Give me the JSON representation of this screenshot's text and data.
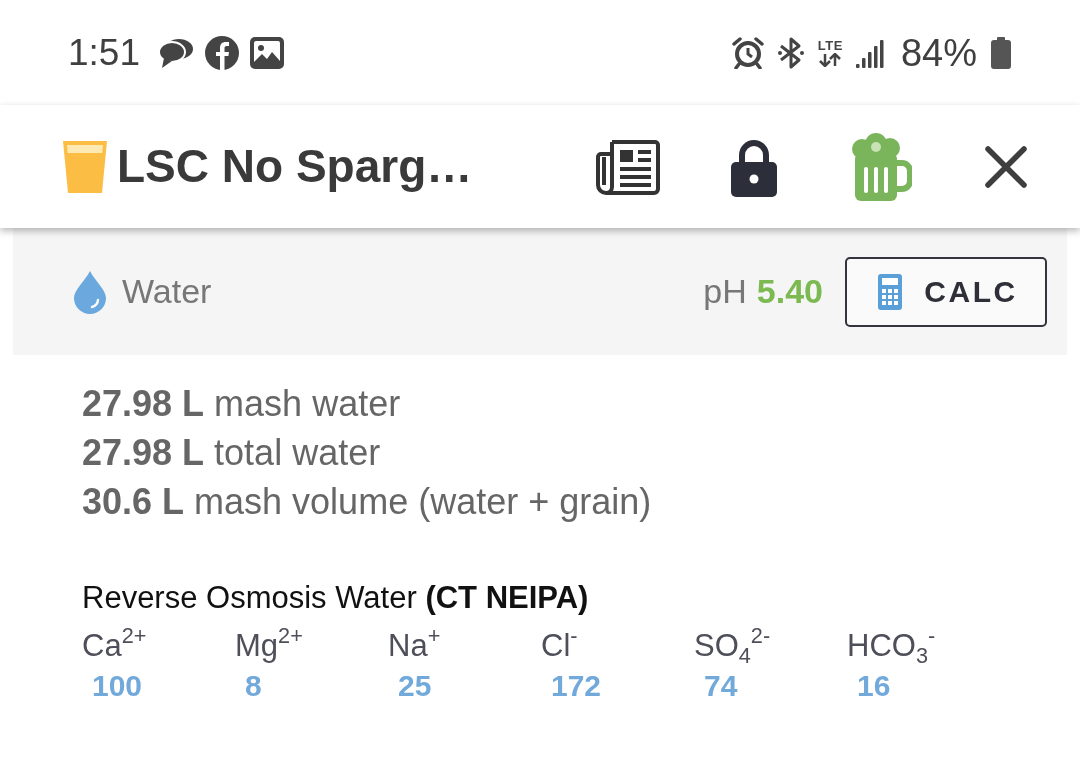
{
  "status_bar": {
    "time": "1:51",
    "network": "LTE",
    "battery": "84%"
  },
  "header": {
    "title": "LSC No Sparg…"
  },
  "water": {
    "title": "Water",
    "ph": {
      "label": "pH",
      "value": "5.40"
    },
    "calc_button": "CALC",
    "volumes": [
      "**27.98 L** mash water",
      "**27.98 L** total water",
      "**30.6 L** mash volume (water + grain)"
    ],
    "profile": {
      "name": "Reverse Osmosis Water **(CT NEIPA)**",
      "ions": [
        {
          "label": "Ca$^{2+}$",
          "value": "100"
        },
        {
          "label": "Mg$^{2+}$",
          "value": "8"
        },
        {
          "label": "Na$^{+}$",
          "value": "25"
        },
        {
          "label": "Cl$^{-}$",
          "value": "172"
        },
        {
          "label": "SO$_{4}$$^{2-}$",
          "value": "74"
        },
        {
          "label": "HCO$_{3}$$^{-}$",
          "value": "16"
        }
      ]
    }
  }
}
